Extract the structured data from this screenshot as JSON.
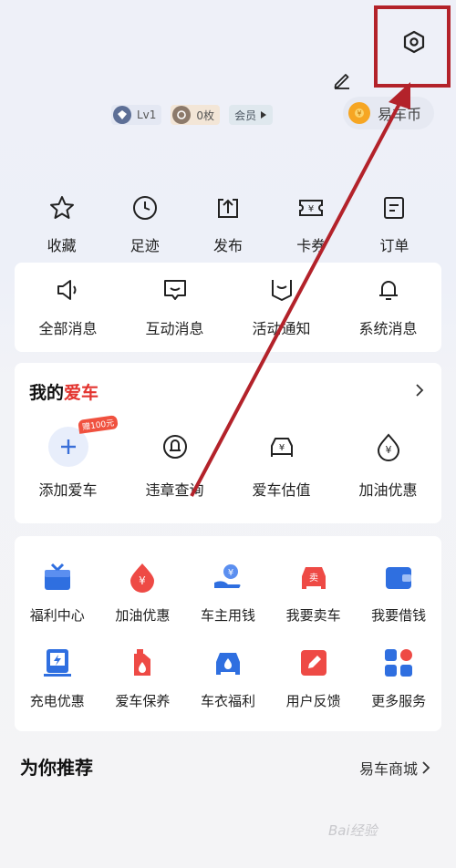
{
  "header": {
    "level_badge": "Lv1",
    "coupon_badge": "0枚",
    "member_badge": "会员",
    "coin_label": "易车币"
  },
  "shortcuts": [
    {
      "label": "收藏",
      "icon": "star-icon"
    },
    {
      "label": "足迹",
      "icon": "clock-icon"
    },
    {
      "label": "发布",
      "icon": "publish-icon"
    },
    {
      "label": "卡券",
      "icon": "ticket-icon"
    },
    {
      "label": "订单",
      "icon": "order-icon"
    }
  ],
  "messages": [
    {
      "label": "全部消息",
      "icon": "speaker-icon"
    },
    {
      "label": "互动消息",
      "icon": "chat-icon"
    },
    {
      "label": "活动通知",
      "icon": "notice-icon"
    },
    {
      "label": "系统消息",
      "icon": "bell-icon"
    }
  ],
  "my_car": {
    "title_prefix": "我的",
    "title_highlight": "爱车",
    "gift_tag": "赠100元",
    "items": [
      {
        "label": "添加爱车",
        "icon": "plus-icon"
      },
      {
        "label": "违章查询",
        "icon": "violation-search-icon"
      },
      {
        "label": "爱车估值",
        "icon": "car-value-icon"
      },
      {
        "label": "加油优惠",
        "icon": "fuel-drop-icon"
      }
    ]
  },
  "services": {
    "row1": [
      {
        "label": "福利中心",
        "icon": "gift-box-icon"
      },
      {
        "label": "加油优惠",
        "icon": "fuel-drop-icon"
      },
      {
        "label": "车主用钱",
        "icon": "hand-money-icon"
      },
      {
        "label": "我要卖车",
        "icon": "sell-car-icon"
      },
      {
        "label": "我要借钱",
        "icon": "wallet-icon"
      }
    ],
    "row2": [
      {
        "label": "充电优惠",
        "icon": "charging-icon"
      },
      {
        "label": "爱车保养",
        "icon": "oil-can-icon"
      },
      {
        "label": "车衣福利",
        "icon": "car-cover-icon"
      },
      {
        "label": "用户反馈",
        "icon": "feedback-icon"
      },
      {
        "label": "更多服务",
        "icon": "grid-icon"
      }
    ]
  },
  "recommend": {
    "title": "为你推荐",
    "link": "易车商城"
  },
  "watermark": "Bai经验",
  "colors": {
    "accent_red": "#e3342f",
    "annotation_red": "#b3222a",
    "service_blue": "#2f6fe0",
    "service_red": "#ee4a45"
  }
}
